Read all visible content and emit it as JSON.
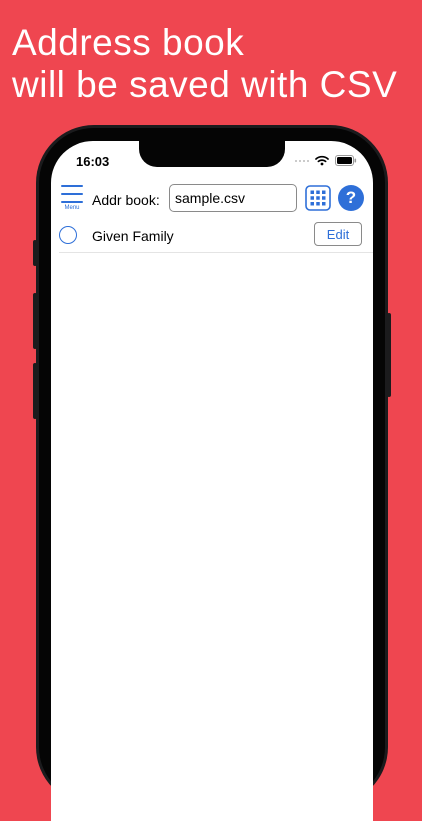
{
  "headline": {
    "line1": "Address book",
    "line2": "will be saved with CSV"
  },
  "status_bar": {
    "time": "16:03",
    "icons": [
      "cellular-signal-icon",
      "wifi-icon",
      "battery-icon"
    ]
  },
  "toolbar": {
    "menu_label": "Menu",
    "addr_label": "Addr book:",
    "file_value": "sample.csv",
    "grid_icon": "grid-icon",
    "help_label": "?"
  },
  "contacts": [
    {
      "name": "Given Family",
      "edit_label": "Edit",
      "selected": false
    }
  ],
  "colors": {
    "background": "#ef4650",
    "accent": "#2e6fd8"
  }
}
